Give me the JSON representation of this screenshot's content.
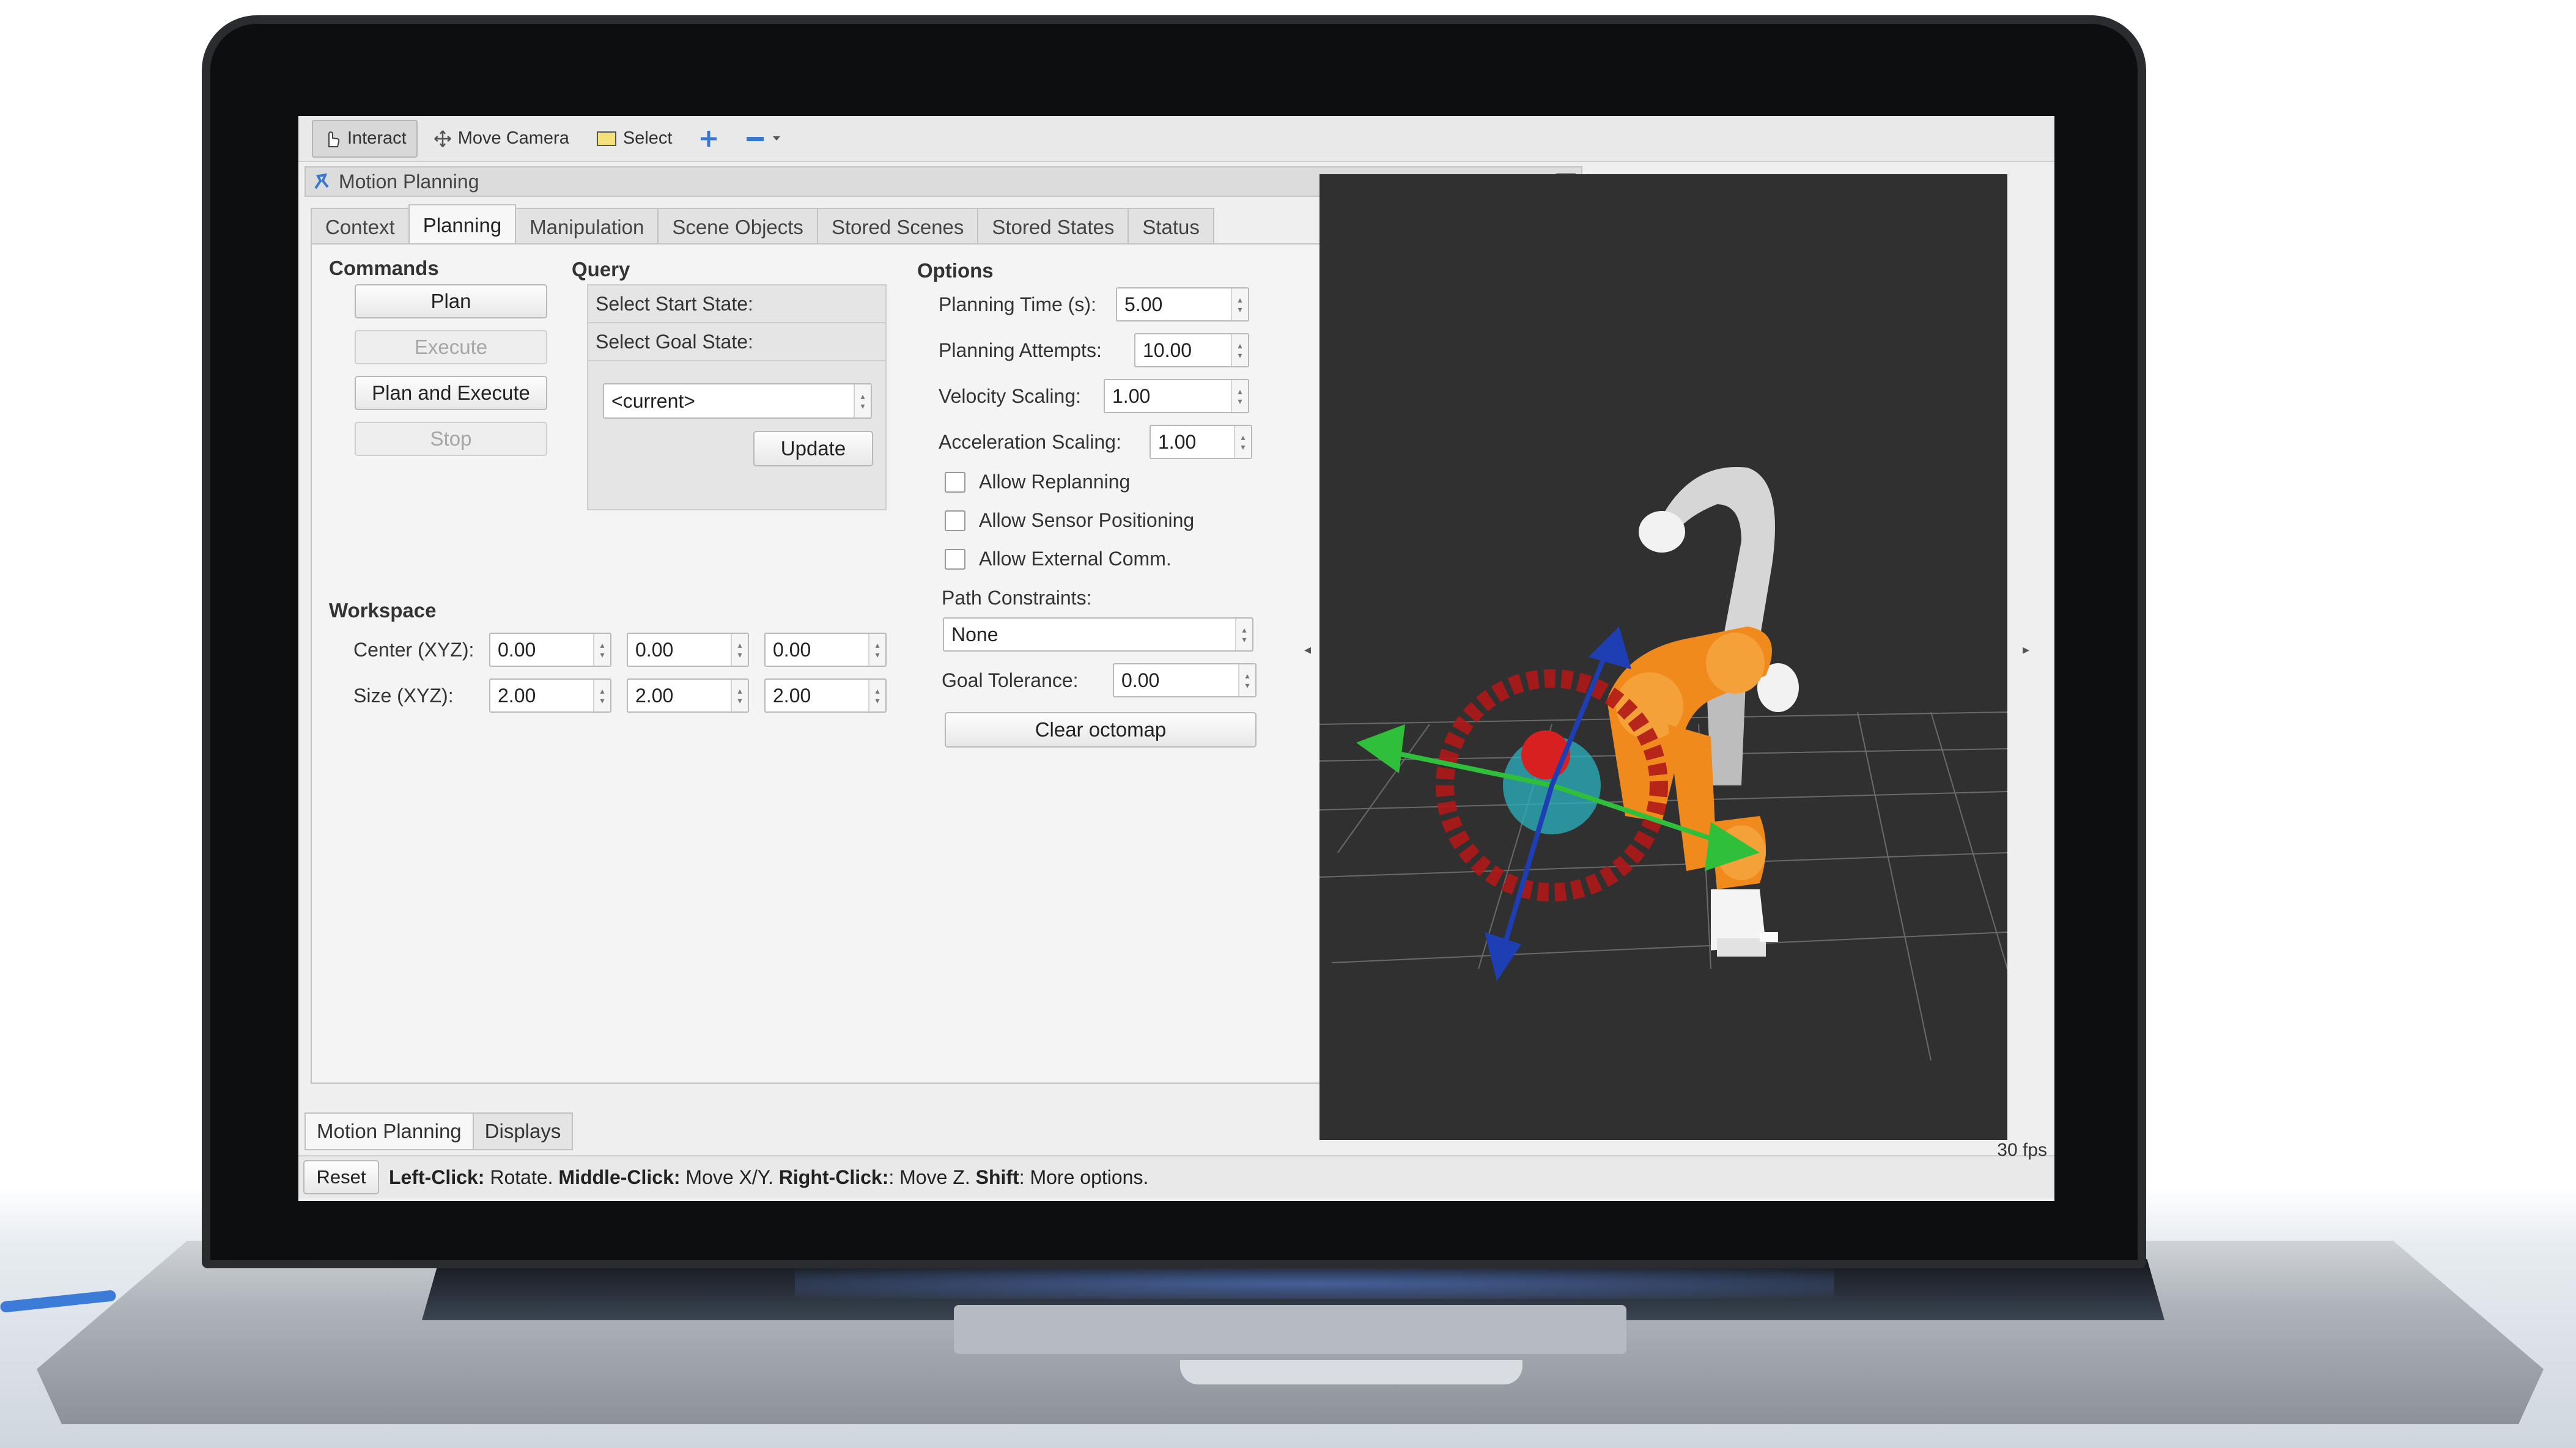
{
  "toolbar": {
    "items": [
      {
        "label": "Interact",
        "icon": "hand-pointer-icon",
        "active": true
      },
      {
        "label": "Move Camera",
        "icon": "move-camera-icon",
        "active": false
      },
      {
        "label": "Select",
        "icon": "select-box-icon",
        "active": false
      }
    ]
  },
  "panel": {
    "title": "Motion Planning",
    "tabs": [
      "Context",
      "Planning",
      "Manipulation",
      "Scene Objects",
      "Stored Scenes",
      "Stored States",
      "Status"
    ],
    "active_tab": "Planning",
    "commands": {
      "heading": "Commands",
      "plan": "Plan",
      "execute": "Execute",
      "plan_and_execute": "Plan and Execute",
      "stop": "Stop"
    },
    "query": {
      "heading": "Query",
      "start_state": "Select Start State:",
      "goal_state": "Select Goal State:",
      "goal_value": "<current>",
      "update": "Update"
    },
    "options": {
      "heading": "Options",
      "planning_time_label": "Planning Time (s):",
      "planning_time": "5.00",
      "planning_attempts_label": "Planning Attempts:",
      "planning_attempts": "10.00",
      "velocity_label": "Velocity Scaling:",
      "velocity": "1.00",
      "acceleration_label": "Acceleration Scaling:",
      "acceleration": "1.00",
      "allow_replanning": "Allow Replanning",
      "allow_sensor": "Allow Sensor Positioning",
      "allow_external": "Allow External Comm.",
      "path_constraints_label": "Path Constraints:",
      "path_constraints": "None",
      "goal_tolerance_label": "Goal Tolerance:",
      "goal_tolerance": "0.00",
      "clear_octomap": "Clear octomap"
    },
    "workspace": {
      "heading": "Workspace",
      "center_label": "Center (XYZ):",
      "center": [
        "0.00",
        "0.00",
        "0.00"
      ],
      "size_label": "Size (XYZ):",
      "size": [
        "2.00",
        "2.00",
        "2.00"
      ]
    },
    "bottom_tabs": [
      "Motion Planning",
      "Displays"
    ]
  },
  "statusbar": {
    "reset": "Reset",
    "left_click": "Left-Click:",
    "left_click_desc": " Rotate. ",
    "middle_click": "Middle-Click:",
    "middle_click_desc": " Move X/Y. ",
    "right_click": "Right-Click:",
    "right_click_desc": ": Move Z. ",
    "shift": "Shift",
    "shift_desc": ": More options.",
    "fps": "30 fps"
  },
  "colors": {
    "viewport_bg": "#303030",
    "robot_orange": "#f08a1c",
    "robot_white": "#f2f2f2",
    "ring_red": "#b01818",
    "arrow_green": "#2fbf3a",
    "arrow_blue": "#1d3fb3",
    "sphere_cyan": "#2ab3c0"
  }
}
